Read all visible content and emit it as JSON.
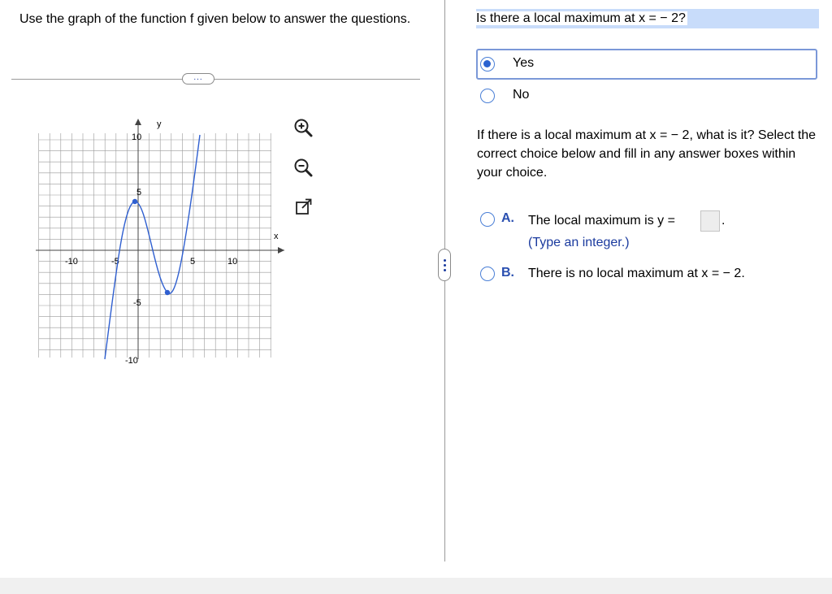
{
  "instructions": "Use the graph of the function f given below to answer the questions.",
  "more_button": "...",
  "graph": {
    "x_axis_label": "x",
    "y_axis_label": "y",
    "x_ticks": [
      "-10",
      "-5",
      "5",
      "10"
    ],
    "y_ticks": [
      "10",
      "5",
      "-5",
      "-10"
    ],
    "curve_color": "#2f5fd0"
  },
  "tools": {
    "zoom_in": "zoom-in-icon",
    "zoom_out": "zoom-out-icon",
    "popout": "popout-icon"
  },
  "question1": {
    "text": "Is there a local maximum at x = − 2?",
    "options": [
      {
        "label": "Yes",
        "selected": true
      },
      {
        "label": "No",
        "selected": false
      }
    ]
  },
  "question2": {
    "prompt": "If there is a local maximum at x = − 2, what is it? Select the correct choice below and fill in any answer boxes within your choice.",
    "choice_a": {
      "letter": "A.",
      "text_before": "The local maximum is y =",
      "text_after": ".",
      "hint": "(Type an integer.)"
    },
    "choice_b": {
      "letter": "B.",
      "text": "There is no local maximum at x = − 2."
    }
  },
  "colors": {
    "accent": "#2a62d0",
    "highlight": "#c8dcfa",
    "letter": "#2a4fb0"
  }
}
